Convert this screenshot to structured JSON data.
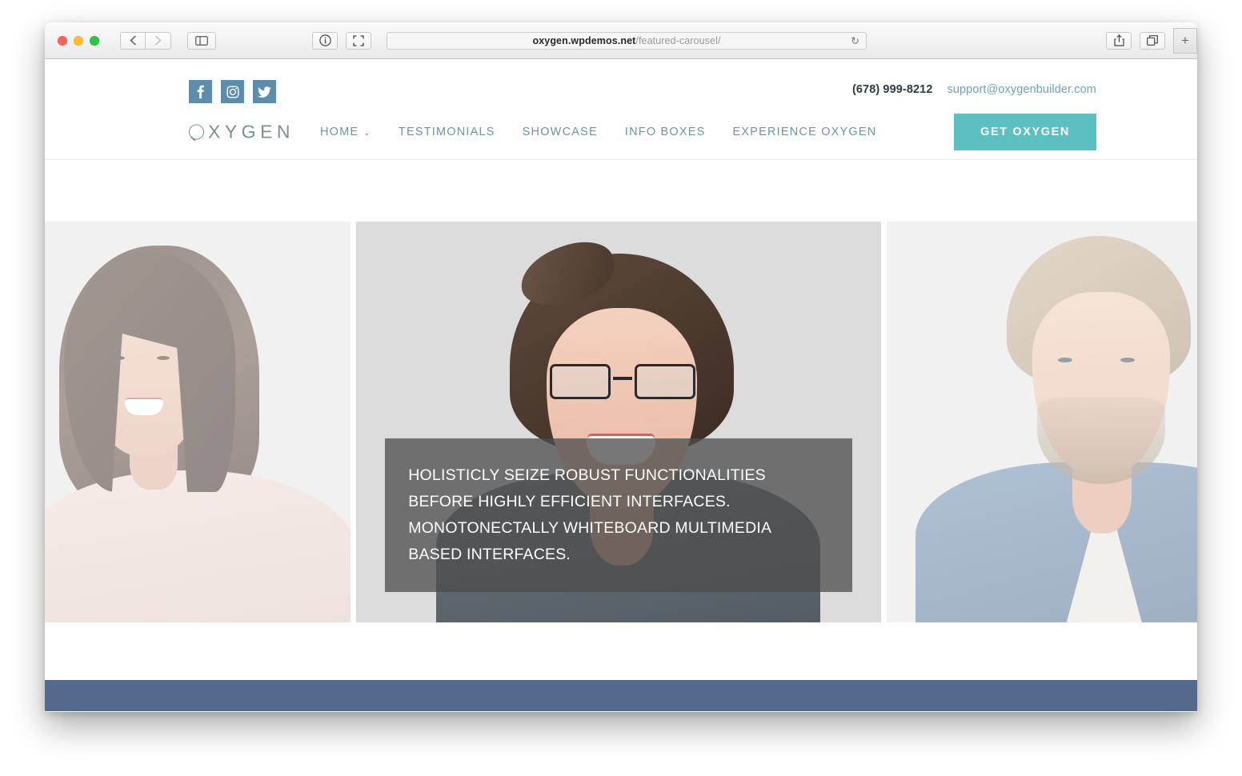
{
  "browser": {
    "window_controls": [
      "close",
      "minimize",
      "zoom"
    ],
    "back_label": "‹",
    "forward_label": "›",
    "sidebar_icon": "sidebar-icon",
    "reader_icon": "reader-icon",
    "fullscreen_icon": "fullscreen-icon",
    "share_icon": "share-icon",
    "tabs_overview_icon": "tabs-overview-icon",
    "new_tab_label": "+",
    "reload_label": "↻",
    "url": {
      "domain": "oxygen.wpdemos.net",
      "path": "/featured-carousel/",
      "full": "oxygen.wpdemos.net/featured-carousel/"
    }
  },
  "site": {
    "topbar": {
      "social": [
        {
          "name": "facebook",
          "label": "f"
        },
        {
          "name": "instagram",
          "label": ""
        },
        {
          "name": "twitter",
          "label": ""
        }
      ],
      "phone": "(678) 999-8212",
      "email": "support@oxygenbuilder.com"
    },
    "header": {
      "logo": "XYGEN",
      "logo_full": "OXYGEN",
      "nav": [
        {
          "label": "HOME",
          "has_dropdown": true,
          "chevron": "⌄"
        },
        {
          "label": "TESTIMONIALS",
          "has_dropdown": false
        },
        {
          "label": "SHOWCASE",
          "has_dropdown": false
        },
        {
          "label": "INFO BOXES",
          "has_dropdown": false
        },
        {
          "label": "EXPERIENCE OXYGEN",
          "has_dropdown": false
        }
      ],
      "cta_label": "GET OXYGEN"
    },
    "carousel": {
      "slides": [
        {
          "id": "prev",
          "alt": "woman with long dark hair",
          "active": false
        },
        {
          "id": "current",
          "alt": "smiling woman with glasses and short hair",
          "active": true
        },
        {
          "id": "next",
          "alt": "man in denim jacket",
          "active": false
        }
      ],
      "caption": "HOLISTICLY SEIZE ROBUST FUNCTIONALITIES BEFORE HIGHLY EFFICIENT INTERFACES. MONOTONECTALLY WHITEBOARD MULTIMEDIA BASED INTERFACES."
    }
  },
  "colors": {
    "accent_teal": "#5cbfc0",
    "social_blue": "#5e8cab",
    "nav_text": "#6d93a4",
    "link_teal": "#6fa3b8",
    "footer_blue": "#54698c",
    "caption_overlay": "rgba(76,76,76,0.76)"
  }
}
